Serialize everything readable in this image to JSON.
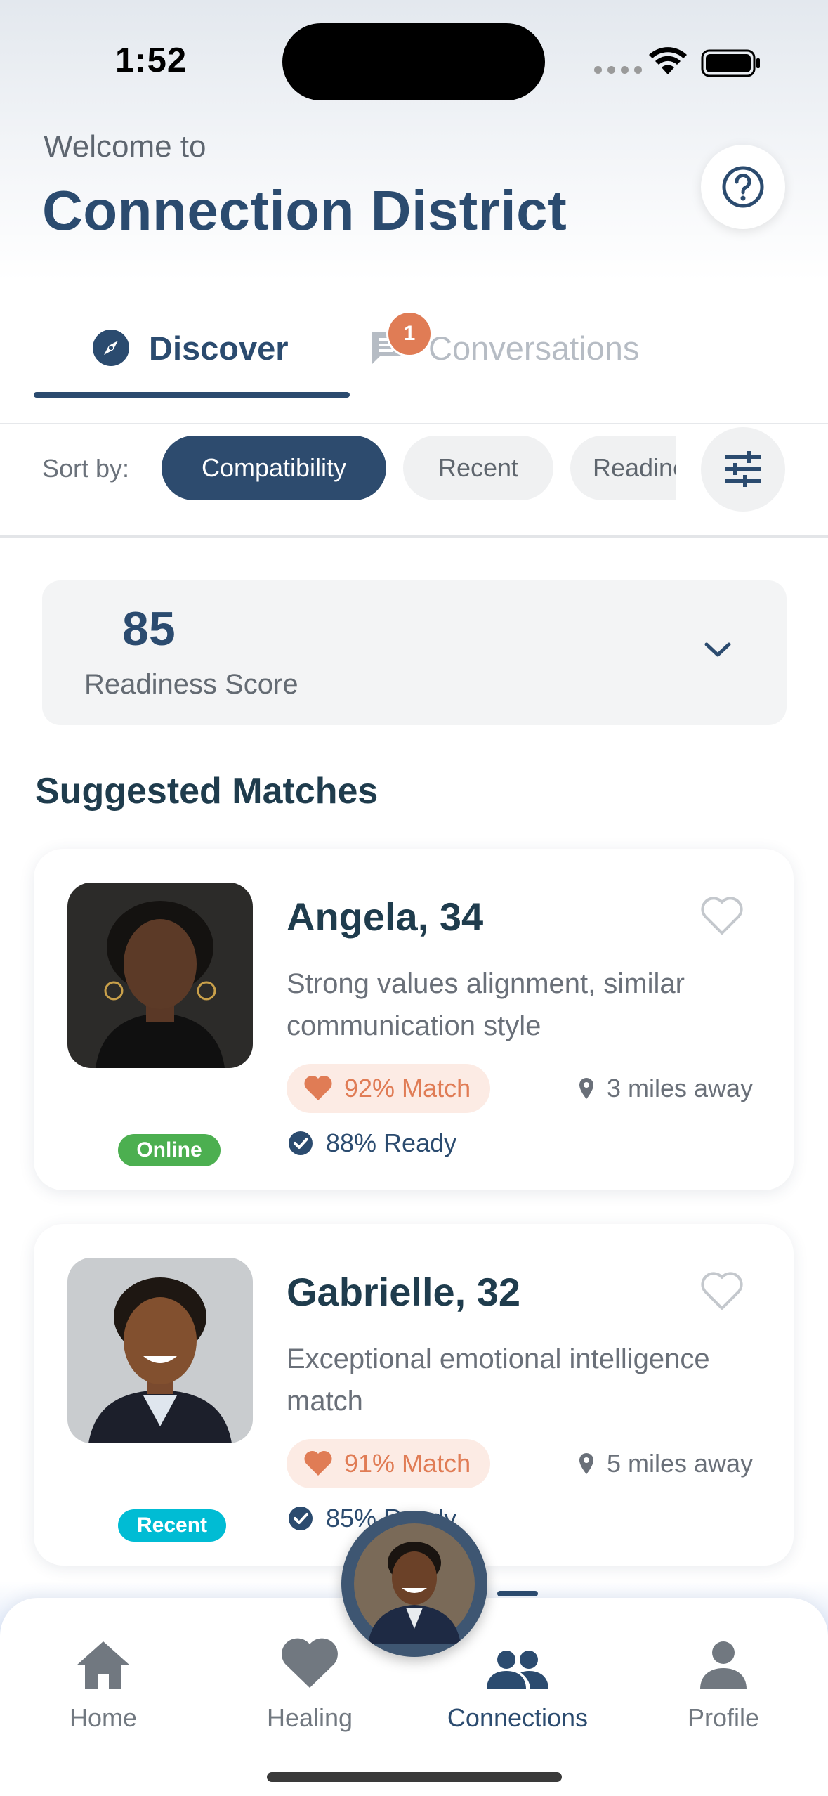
{
  "status_bar": {
    "time": "1:52"
  },
  "header": {
    "welcome": "Welcome to",
    "title": "Connection District"
  },
  "tabs": [
    {
      "label": "Discover",
      "active": true
    },
    {
      "label": "Conversations",
      "active": false,
      "badge": "1"
    }
  ],
  "sort": {
    "label": "Sort by:",
    "options": [
      "Compatibility",
      "Recent",
      "Readiness"
    ],
    "selected": "Compatibility"
  },
  "readiness": {
    "value": "85",
    "label": "Readiness Score"
  },
  "section_title": "Suggested Matches",
  "matches": [
    {
      "name": "Angela, 34",
      "description": "Strong values alignment, similar communication style",
      "match": "92% Match",
      "distance": "3 miles away",
      "ready": "88% Ready",
      "status": "Online"
    },
    {
      "name": "Gabrielle, 32",
      "description": "Exceptional emotional intelligence match",
      "match": "91% Match",
      "distance": "5 miles away",
      "ready": "85% Ready",
      "status": "Recent"
    }
  ],
  "nav": {
    "items": [
      "Home",
      "Healing",
      "Connections",
      "Profile"
    ],
    "active": "Connections"
  },
  "colors": {
    "primary": "#2b4b6f",
    "accent": "#e07c55",
    "online": "#4caf50",
    "recent": "#00bcd4"
  },
  "icons": [
    "help-icon",
    "compass-icon",
    "chat-icon",
    "filter-icon",
    "chevron-down-icon",
    "heart-outline-icon",
    "heart-icon",
    "location-pin-icon",
    "check-circle-icon",
    "home-icon",
    "people-icon",
    "person-icon"
  ]
}
